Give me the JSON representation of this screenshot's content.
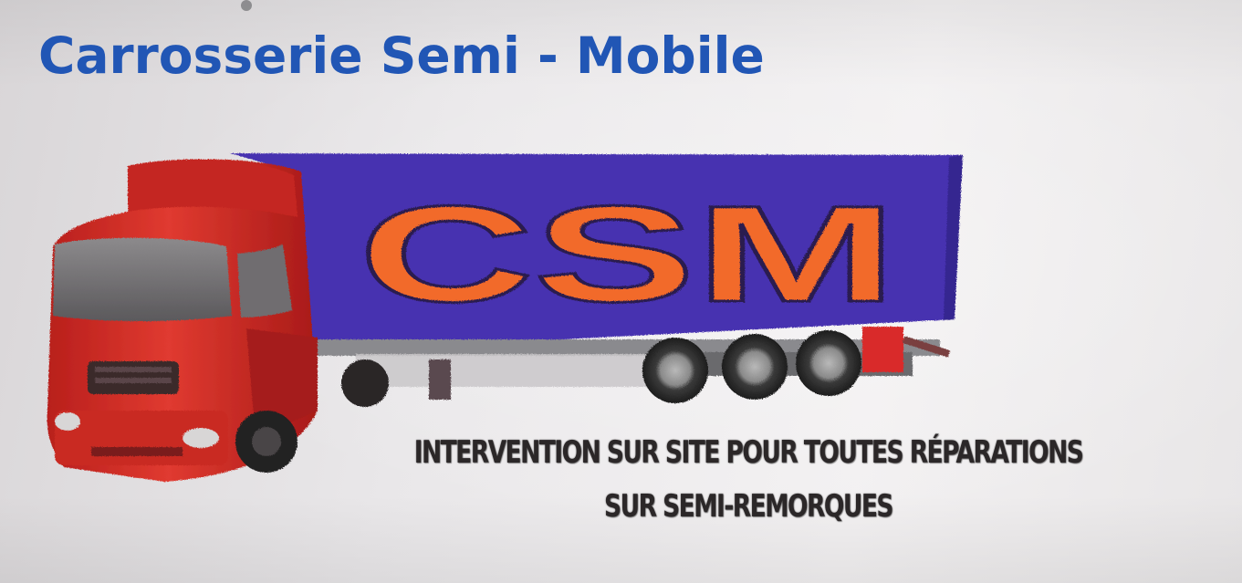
{
  "heading": {
    "text": "Carrosserie Semi - Mobile",
    "color": "#2156b5"
  },
  "logo": {
    "brand_text": "CSM",
    "trailer_color": "#4630b0",
    "cab_color": "#d9332a",
    "lettering_color": "#f26b2a",
    "lettering_shadow_color": "#2a1a4f"
  },
  "tagline": {
    "line_1": "INTERVENTION SUR SITE POUR TOUTES RÉPARATIONS",
    "line_2": "SUR SEMI-REMORQUES",
    "color": "#2b2728"
  }
}
